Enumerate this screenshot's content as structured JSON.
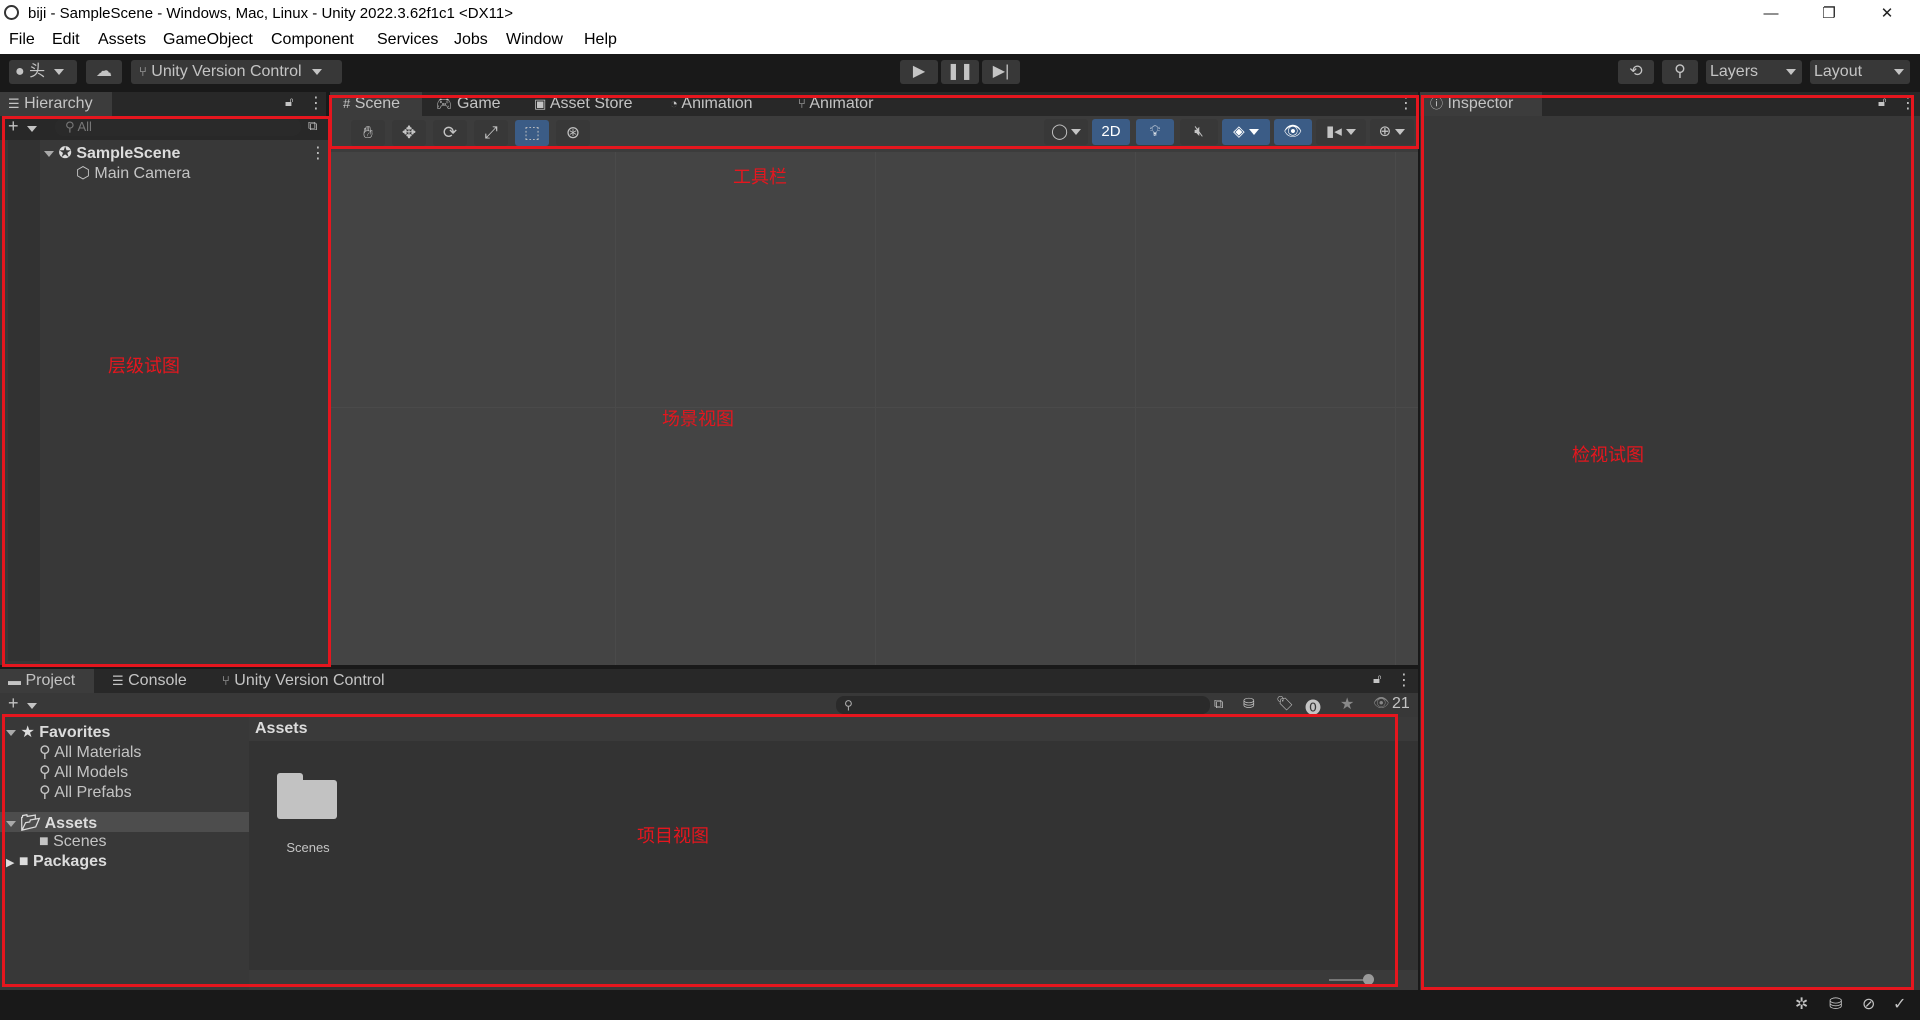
{
  "window": {
    "title": "biji - SampleScene - Windows, Mac, Linux - Unity 2022.3.62f1c1 <DX11>",
    "minimize": "—",
    "restore": "❐",
    "close": "✕"
  },
  "menu": [
    "File",
    "Edit",
    "Assets",
    "GameObject",
    "Component",
    "Services",
    "Jobs",
    "Window",
    "Help"
  ],
  "toolbar": {
    "account_glyph": "头",
    "version_control": "Unity Version Control",
    "layers": "Layers",
    "layout": "Layout"
  },
  "hierarchy": {
    "tab": "Hierarchy",
    "search_placeholder": "All",
    "scene": "SampleScene",
    "objects": [
      "Main Camera"
    ]
  },
  "scene_tabs": [
    "Scene",
    "Game",
    "Asset Store",
    "Animation",
    "Animator"
  ],
  "scene_toolbar": {
    "mode_2d": "2D"
  },
  "inspector": {
    "tab": "Inspector"
  },
  "project": {
    "tabs": [
      "Project",
      "Console",
      "Unity Version Control"
    ],
    "hidden_count": "21",
    "favorites_label": "Favorites",
    "favorites": [
      "All Materials",
      "All Models",
      "All Prefabs"
    ],
    "assets_label": "Assets",
    "asset_folders": [
      "Scenes"
    ],
    "packages_label": "Packages",
    "breadcrumb": "Assets",
    "grid_items": [
      "Scenes"
    ]
  },
  "annotations": {
    "hierarchy": "层级试图",
    "toolbar": "工具栏",
    "scene": "场景视图",
    "inspector": "检视试图",
    "project": "项目视图"
  },
  "colors": {
    "annotation_red": "#e5161e",
    "editor_bg": "#191919",
    "panel_bg": "#383838",
    "active_blue": "#3b5c86"
  }
}
